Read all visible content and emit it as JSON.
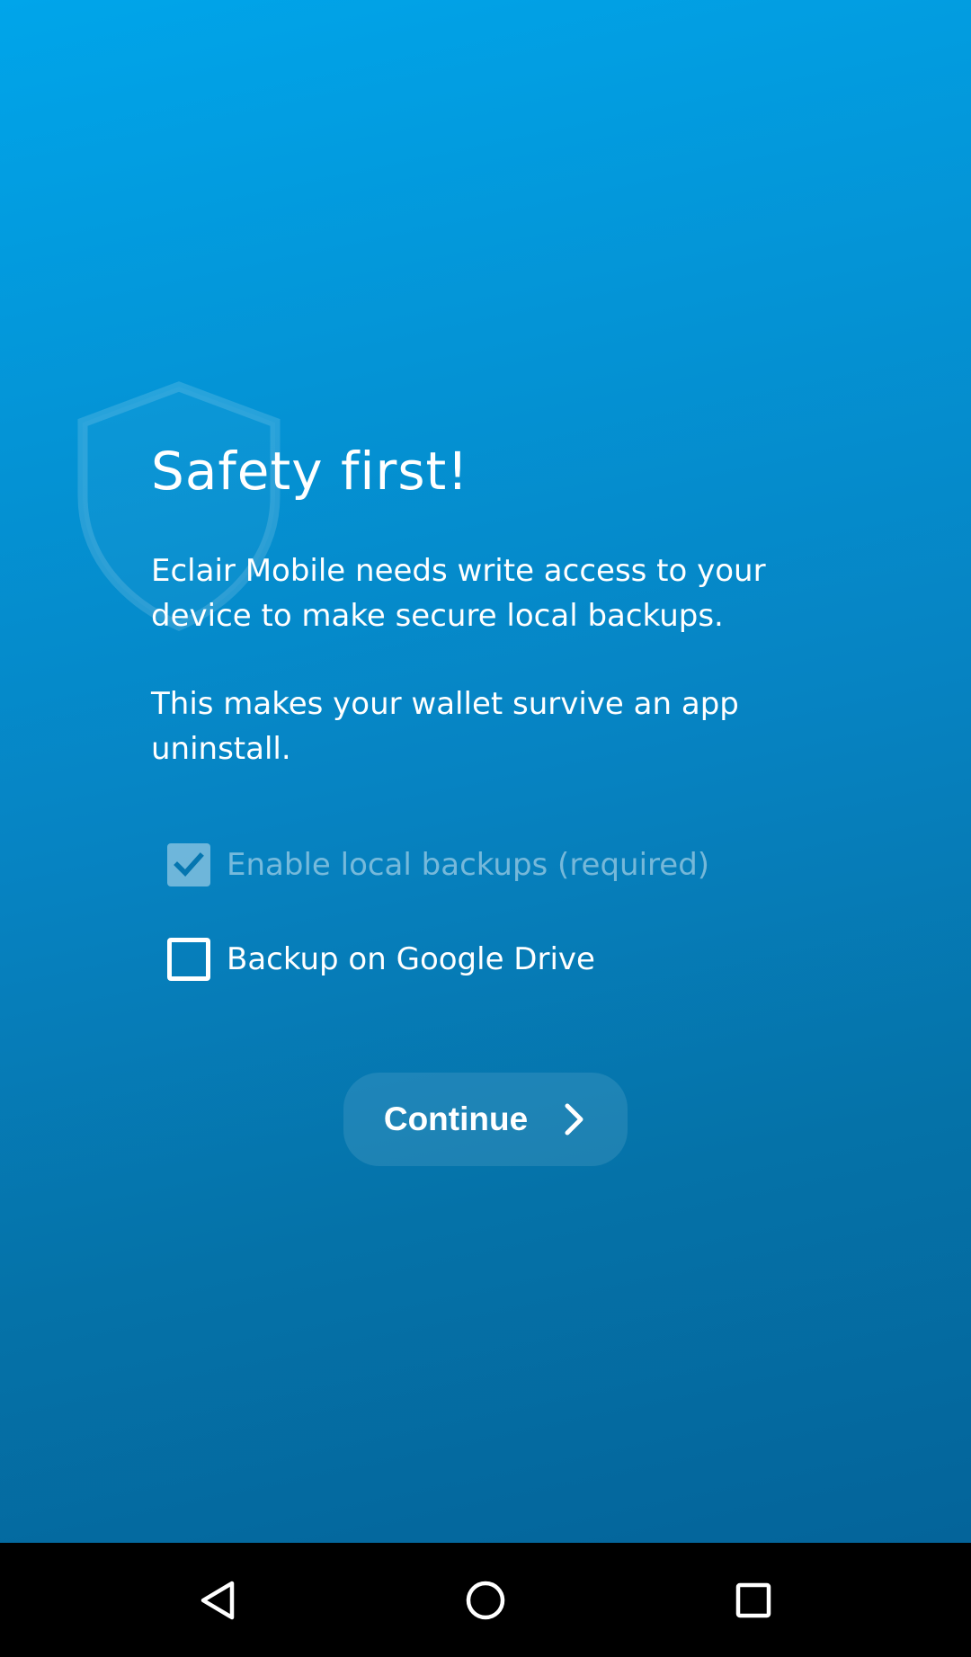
{
  "page": {
    "title": "Safety first!",
    "paragraph_1": "Eclair Mobile needs write access to your device to make secure local backups.",
    "paragraph_2": "This makes your wallet survive an app uninstall."
  },
  "options": {
    "local_backup": {
      "label": "Enable local backups (required)",
      "checked": true,
      "enabled": false
    },
    "google_drive_backup": {
      "label": "Backup on Google Drive",
      "checked": false,
      "enabled": true
    }
  },
  "continue_button": {
    "label": "Continue",
    "icon": "chevron-right-icon"
  },
  "decoration": {
    "icon": "shield-icon"
  },
  "navigation_bar": {
    "icons": [
      "back-icon",
      "home-icon",
      "recents-icon"
    ]
  },
  "colors": {
    "background_top": "#00a5ea",
    "background_bottom": "#04649a",
    "text": "#ffffff",
    "navbar": "#000000"
  }
}
